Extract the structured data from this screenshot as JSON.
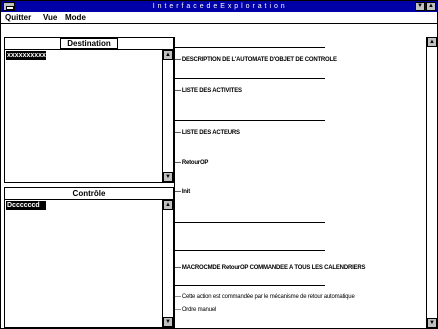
{
  "window": {
    "title": "I n t e r f a c e   d e   E x p l o r a t i o n"
  },
  "menu": {
    "items": [
      {
        "label": "Quitter"
      },
      {
        "label": "Vue"
      },
      {
        "label": "Mode"
      }
    ]
  },
  "left": {
    "top_box": {
      "header": "Destination",
      "selected": "xxxxxxxxxx"
    },
    "bottom_box": {
      "header": "Contrôle",
      "selected": "Dccccccd"
    }
  },
  "right": {
    "rows": [
      {
        "text": "DESCRIPTION DE L'AUTOMATE D'OBJET DE CONTROLE"
      },
      {
        "text": "LISTE DES ACTIVITES"
      },
      {
        "text": "LISTE DES ACTEURS"
      },
      {
        "text": "RetourOP"
      },
      {
        "text": "Init"
      },
      {
        "text": "MACROCMDE RetourOP COMMANDEE A TOUS LES CALENDRIERS"
      },
      {
        "text": "Cette action est commandée par le mécanisme de retour automatique"
      },
      {
        "text": "Ordre manuel"
      }
    ]
  },
  "icons": {
    "system_menu": "system-menu-icon",
    "minimize": "minimize-icon",
    "maximize": "maximize-icon",
    "scroll_up": "arrow-up-icon",
    "scroll_down": "arrow-down-icon"
  }
}
